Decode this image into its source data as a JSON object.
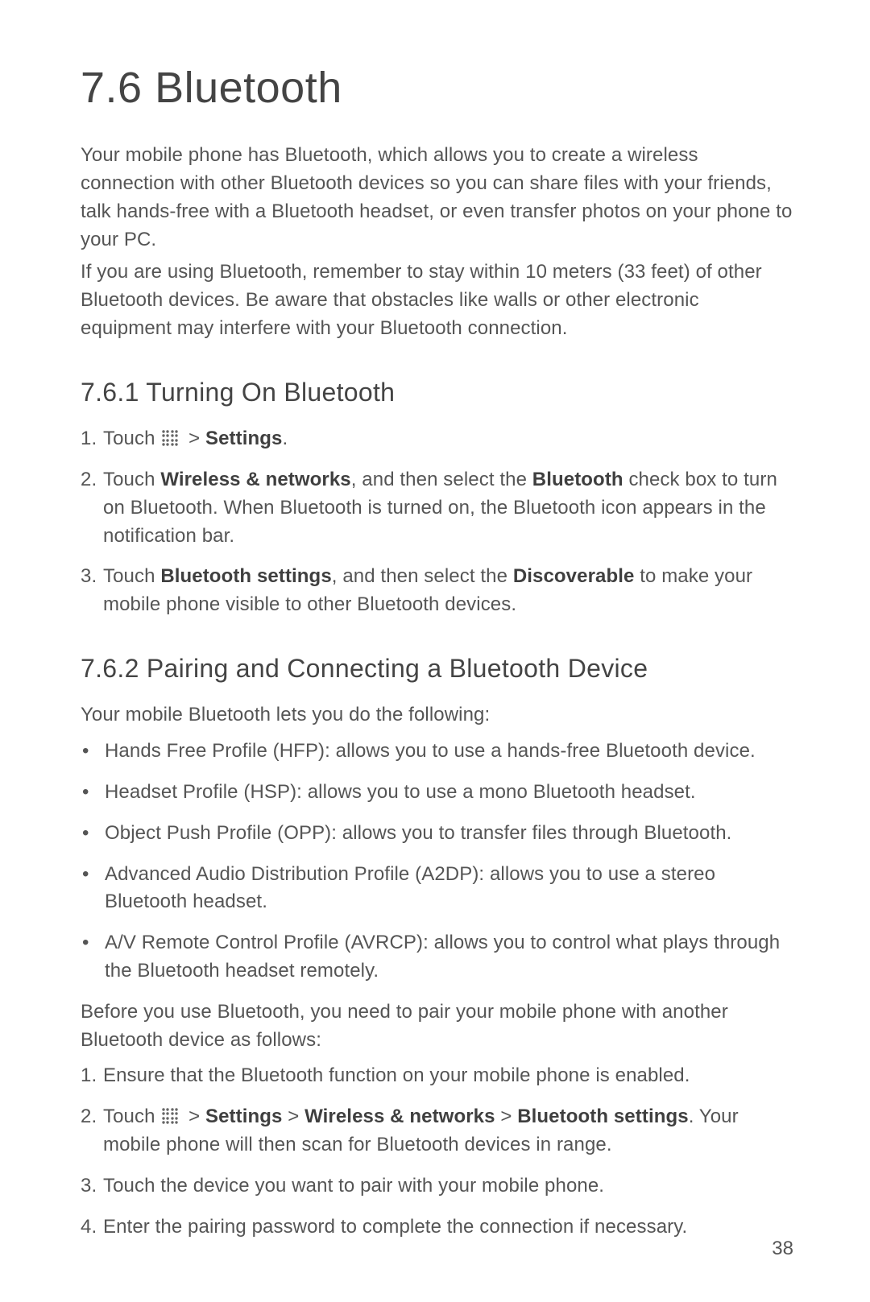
{
  "title": "7.6  Bluetooth",
  "intro1": "Your mobile phone has Bluetooth, which allows you to create a wireless connection with other Bluetooth devices so you can share files with your friends, talk hands-free with a Bluetooth headset, or even transfer photos on your phone to your PC.",
  "intro2": "If you are using Bluetooth, remember to stay within 10 meters (33 feet) of other Bluetooth devices. Be aware that obstacles like walls or other electronic equipment may interfere with your Bluetooth connection.",
  "s761": {
    "heading": "7.6.1  Turning On Bluetooth",
    "steps": {
      "n1": "1.",
      "t1a": "Touch ",
      "t1b": " > ",
      "t1c": "Settings",
      "t1d": ".",
      "n2": "2.",
      "t2a": "Touch ",
      "t2b": "Wireless & networks",
      "t2c": ", and then select the ",
      "t2d": "Bluetooth",
      "t2e": " check box to turn on Bluetooth. When Bluetooth is turned on, the Bluetooth icon appears in the notification bar.",
      "n3": "3.",
      "t3a": "Touch ",
      "t3b": "Bluetooth settings",
      "t3c": ", and then select the ",
      "t3d": "Discoverable",
      "t3e": " to make your mobile phone visible to other Bluetooth devices."
    }
  },
  "s762": {
    "heading": "7.6.2  Pairing and Connecting a Bluetooth Device",
    "lead": "Your mobile Bluetooth lets you do the following:",
    "bullets": {
      "b1": "Hands Free Profile (HFP): allows you to use a hands-free Bluetooth device.",
      "b2": "Headset Profile (HSP): allows you to use a mono Bluetooth headset.",
      "b3": "Object Push Profile (OPP): allows you to transfer files through Bluetooth.",
      "b4": "Advanced Audio Distribution Profile (A2DP): allows you to use a stereo Bluetooth headset.",
      "b5": "A/V Remote Control Profile (AVRCP): allows you to control what plays through the Bluetooth headset remotely."
    },
    "lead2": "Before you use Bluetooth, you need to pair your mobile phone with another Bluetooth device as follows:",
    "steps": {
      "n1": "1.",
      "t1": "Ensure that the Bluetooth function on your mobile phone is enabled.",
      "n2": "2.",
      "t2a": "Touch ",
      "t2b": " > ",
      "t2c": "Settings",
      "t2d": " > ",
      "t2e": "Wireless & networks",
      "t2f": " > ",
      "t2g": "Bluetooth settings",
      "t2h": ". Your mobile phone will then scan for Bluetooth devices in range.",
      "n3": "3.",
      "t3": "Touch the device you want to pair with your mobile phone.",
      "n4": "4.",
      "t4": "Enter the pairing password to complete the connection if necessary."
    }
  },
  "page_number": "38",
  "bullet_char": "•"
}
